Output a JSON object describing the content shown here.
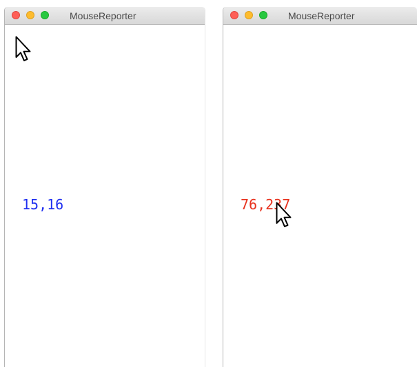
{
  "windows": [
    {
      "title": "MouseReporter",
      "coordinate_text": "15,16",
      "coordinate_color": "#1e2ef0",
      "cursor_icon": "arrow-cursor-icon"
    },
    {
      "title": "MouseReporter",
      "coordinate_text": "76,237",
      "coordinate_color": "#e8321e",
      "cursor_icon": "arrow-cursor-icon"
    }
  ],
  "colors": {
    "close": "#fe5f57",
    "minimize": "#febc2e",
    "zoom": "#28c840"
  }
}
